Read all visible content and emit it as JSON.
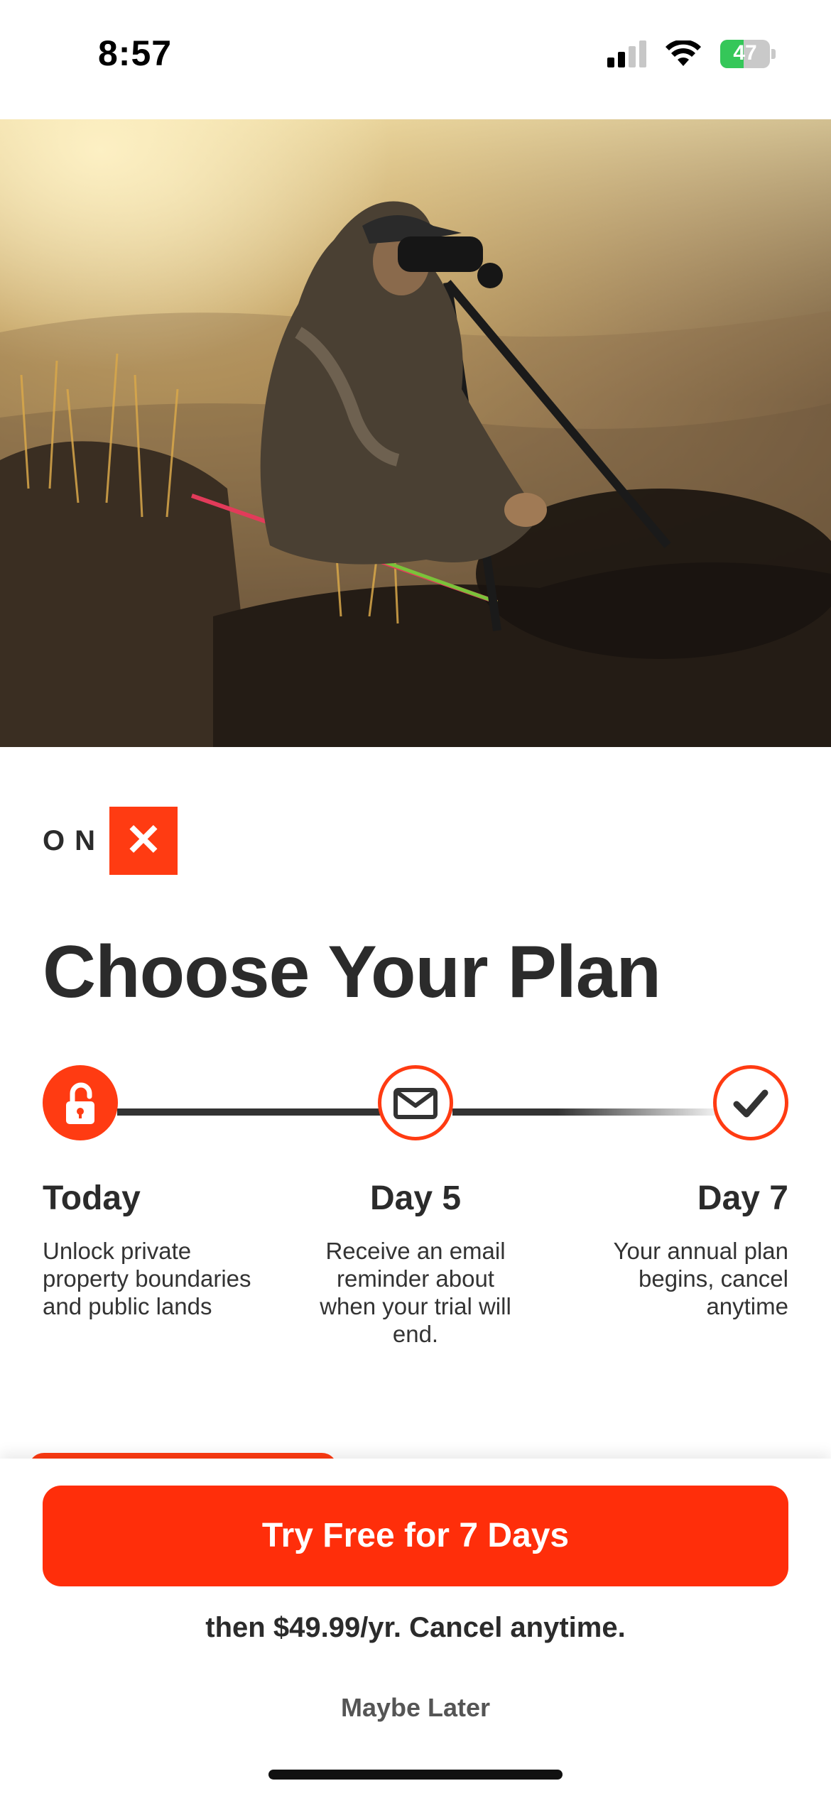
{
  "status_bar": {
    "time": "8:57",
    "battery_percent": "47",
    "battery_level": 0.47,
    "icons": [
      "signal-icon",
      "wifi-icon",
      "battery-charging-icon"
    ]
  },
  "hero": {
    "image": "hunter-with-binoculars-photo"
  },
  "brand": {
    "logo_text": "ON",
    "logo_mark": "✕",
    "accent": "#ff3b12"
  },
  "page_title": "Choose Your Plan",
  "timeline": [
    {
      "title": "Today",
      "description": "Unlock private property boundaries and public lands",
      "icon": "unlock-icon"
    },
    {
      "title": "Day 5",
      "description": "Receive an email reminder about when your trial will end.",
      "icon": "envelope-icon"
    },
    {
      "title": "Day 7",
      "description": "Your annual plan begins, cancel anytime",
      "icon": "checkmark-icon"
    }
  ],
  "cta": {
    "button_label": "Try Free for 7 Days",
    "price_note": "then $49.99/yr. Cancel anytime.",
    "secondary_label": "Maybe Later",
    "button_color": "#ff2e0a"
  }
}
